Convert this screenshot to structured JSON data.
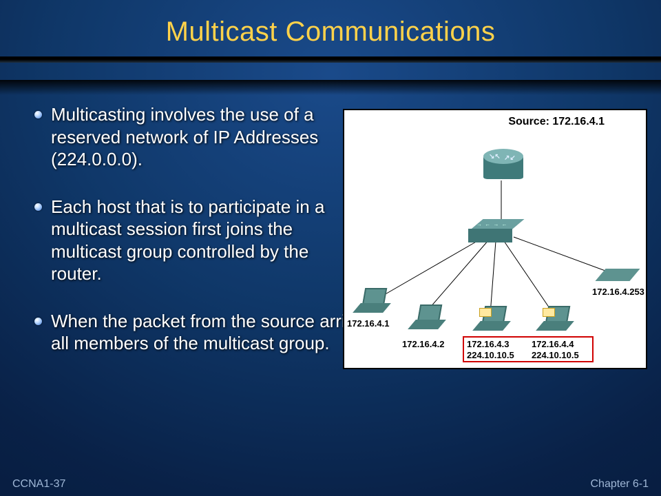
{
  "title": "Multicast Communications",
  "bullets": {
    "b1": "Multicasting involves the use of a reserved network of IP Addresses (224.0.0.0).",
    "b2": "Each host that is to participate in a multicast session first joins the multicast group controlled by the router.",
    "b3": "When the packet from the source arrives at the router, it is forwarded to all members of the multicast group."
  },
  "diagram": {
    "source_label": "Source: 172.16.4.1",
    "hosts": {
      "h1_ip": "172.16.4.1",
      "h2_ip": "172.16.4.2",
      "h3_ip": "172.16.4.3",
      "h3_mcast": "224.10.10.5",
      "h4_ip": "172.16.4.4",
      "h4_mcast": "224.10.10.5",
      "h5_ip": "172.16.4.253"
    }
  },
  "footer": {
    "left": "CCNA1-37",
    "right": "Chapter 6-1"
  }
}
